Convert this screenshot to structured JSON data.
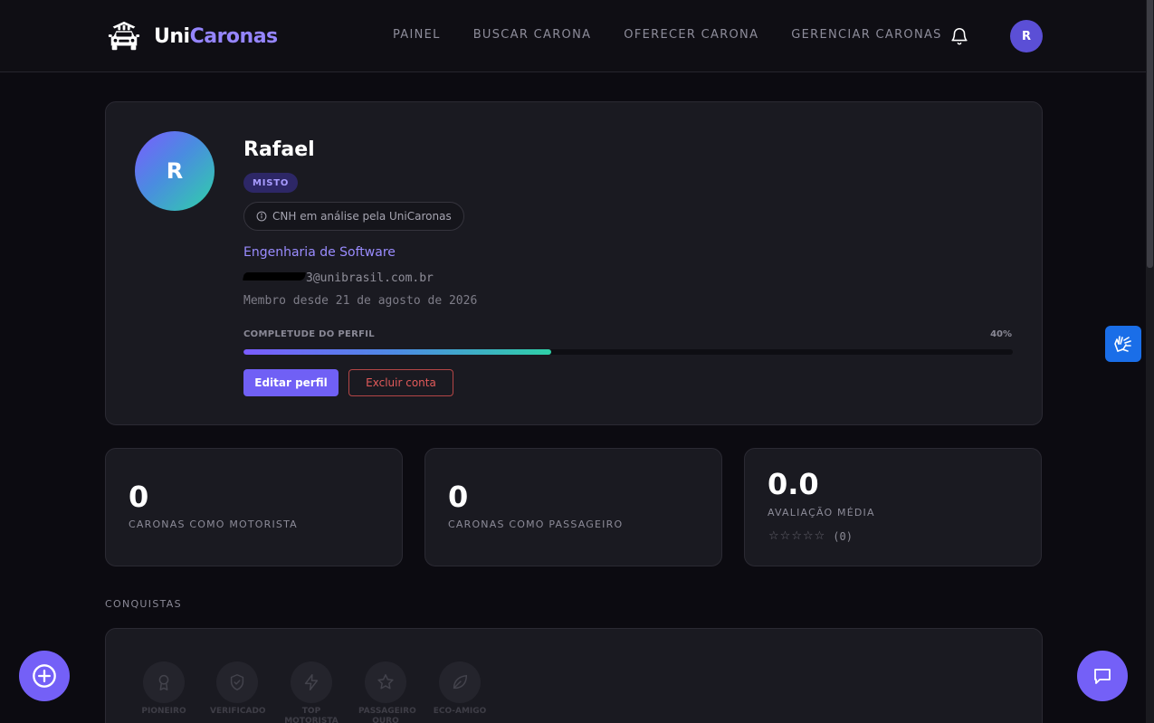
{
  "brand": {
    "name_part1": "Uni",
    "name_part2": "Caronas"
  },
  "nav": {
    "items": [
      "PAINEL",
      "BUSCAR CARONA",
      "OFERECER CARONA",
      "GERENCIAR CARONAS"
    ],
    "avatar_initial": "R"
  },
  "profile": {
    "initial": "R",
    "name": "Rafael",
    "role_badge": "MISTO",
    "cnh_status": "CNH em análise pela UniCaronas",
    "course": "Engenharia de Software",
    "email_visible": "3@unibrasil.com.br",
    "member_since": "Membro desde 21 de agosto de 2026",
    "completeness_label": "COMPLETUDE DO PERFIL",
    "completeness_percent": 40,
    "completeness_text": "40%",
    "edit_label": "Editar perfil",
    "delete_label": "Excluir conta"
  },
  "stats": {
    "driver_rides_value": "0",
    "driver_rides_label": "CARONAS COMO MOTORISTA",
    "passenger_rides_value": "0",
    "passenger_rides_label": "CARONAS COMO PASSAGEIRO",
    "rating_value": "0.0",
    "rating_label": "AVALIAÇÃO MÉDIA",
    "rating_stars": 0,
    "rating_count": "(0)"
  },
  "achievements": {
    "title": "CONQUISTAS",
    "items": [
      {
        "label": "PIONEIRO",
        "icon": "award-icon"
      },
      {
        "label": "VERIFICADO",
        "icon": "shield-check-icon"
      },
      {
        "label": "TOP MOTORISTA",
        "icon": "lightning-icon"
      },
      {
        "label": "PASSAGEIRO OURO",
        "icon": "star-icon"
      },
      {
        "label": "ECO-AMIGO",
        "icon": "leaf-icon"
      }
    ]
  },
  "colors": {
    "accent": "#7460f7",
    "background": "#0c0b11",
    "card": "#1a1a21",
    "danger": "#e25a5a",
    "accessibility": "#1a6ee8"
  }
}
